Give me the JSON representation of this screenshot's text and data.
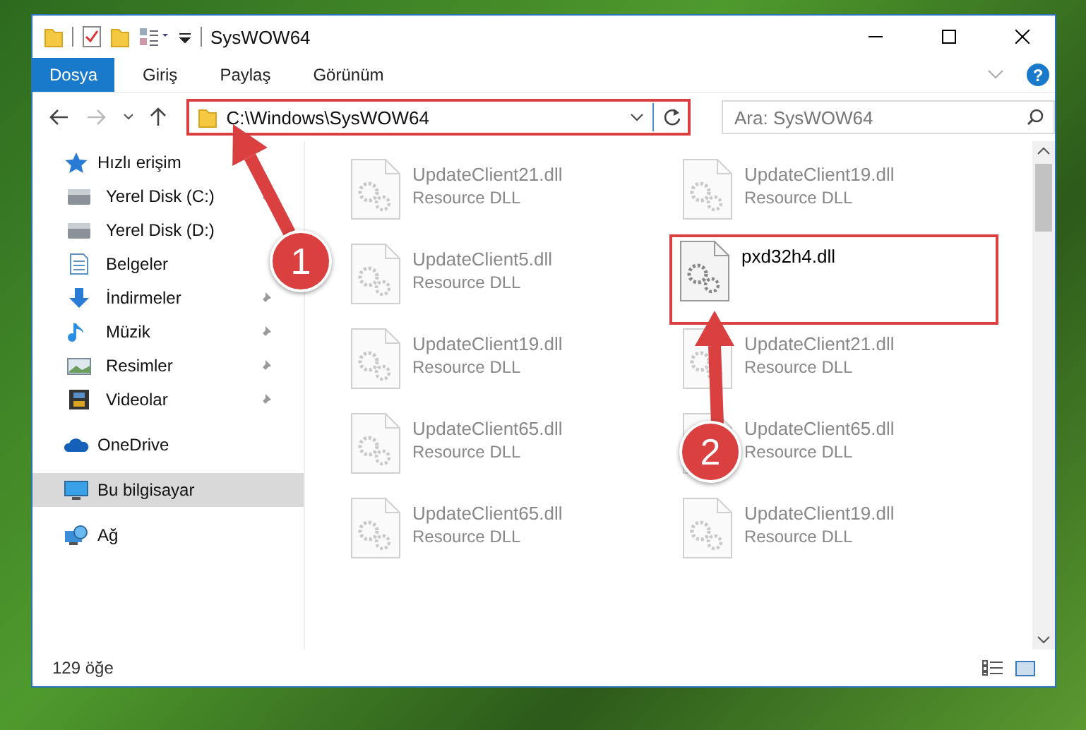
{
  "window": {
    "title": "SysWOW64"
  },
  "ribbon_tabs": [
    {
      "label": "Dosya",
      "selected": true
    },
    {
      "label": "Giriş",
      "selected": false
    },
    {
      "label": "Paylaş",
      "selected": false
    },
    {
      "label": "Görünüm",
      "selected": false
    }
  ],
  "help_button": "?",
  "address": {
    "path": "C:\\Windows\\SysWOW64",
    "highlighted": true
  },
  "search": {
    "placeholder": "Ara: SysWOW64"
  },
  "sidebar": {
    "items": [
      {
        "label": "Hızlı erişim",
        "kind": "star",
        "selected": false,
        "children": [
          {
            "label": "Yerel Disk (C:)",
            "kind": "drive",
            "pinned": true,
            "selected": false
          },
          {
            "label": "Yerel Disk (D:)",
            "kind": "drive",
            "pinned": false,
            "selected": false
          },
          {
            "label": "Belgeler",
            "kind": "documents",
            "pinned": false,
            "selected": false
          },
          {
            "label": "İndirmeler",
            "kind": "download",
            "pinned": true,
            "selected": false
          },
          {
            "label": "Müzik",
            "kind": "music",
            "pinned": true,
            "selected": false
          },
          {
            "label": "Resimler",
            "kind": "pictures",
            "pinned": true,
            "selected": false
          },
          {
            "label": "Videolar",
            "kind": "videos",
            "pinned": true,
            "selected": false
          }
        ]
      },
      {
        "label": "OneDrive",
        "kind": "cloud",
        "selected": false
      },
      {
        "label": "Bu bilgisayar",
        "kind": "computer",
        "selected": true
      },
      {
        "label": "Ağ",
        "kind": "network",
        "selected": false
      }
    ]
  },
  "files": [
    {
      "name": "UpdateClient21.dll",
      "type": "Resource DLL",
      "blurred": true,
      "highlighted": false
    },
    {
      "name": "UpdateClient19.dll",
      "type": "Resource DLL",
      "blurred": true,
      "highlighted": false
    },
    {
      "name": "UpdateClient5.dll",
      "type": "Resource DLL",
      "blurred": true,
      "highlighted": false
    },
    {
      "name": "pxd32h4.dll",
      "blurred": false,
      "highlighted": true
    },
    {
      "name": "UpdateClient19.dll",
      "type": "Resource DLL",
      "blurred": true,
      "highlighted": false
    },
    {
      "name": "UpdateClient21.dll",
      "type": "Resource DLL",
      "blurred": true,
      "highlighted": false
    },
    {
      "name": "UpdateClient65.dll",
      "type": "Resource DLL",
      "blurred": true,
      "highlighted": false
    },
    {
      "name": "UpdateClient65.dll",
      "type": "Resource DLL",
      "blurred": true,
      "highlighted": false
    },
    {
      "name": "UpdateClient65.dll",
      "type": "Resource DLL",
      "blurred": true,
      "highlighted": false
    },
    {
      "name": "UpdateClient19.dll",
      "type": "Resource DLL",
      "blurred": true,
      "highlighted": false
    }
  ],
  "status_bar": {
    "count": "129 öğe"
  },
  "annotations": [
    {
      "number": "1"
    },
    {
      "number": "2"
    }
  ]
}
